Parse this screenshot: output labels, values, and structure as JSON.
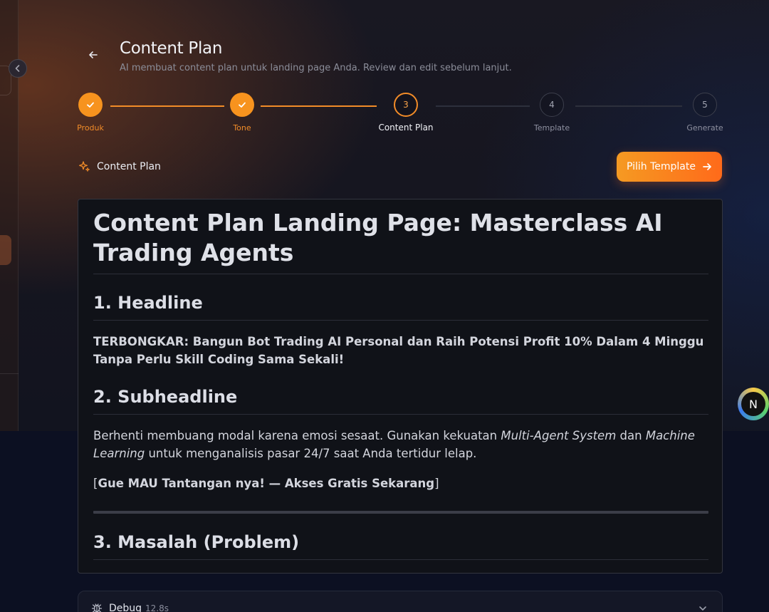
{
  "header": {
    "title": "Content Plan",
    "subtitle": "AI membuat content plan untuk landing page Anda. Review dan edit sebelum lanjut."
  },
  "stepper": {
    "steps": [
      {
        "label": "Produk",
        "number": "1",
        "state": "done"
      },
      {
        "label": "Tone",
        "number": "2",
        "state": "done"
      },
      {
        "label": "Content Plan",
        "number": "3",
        "state": "active"
      },
      {
        "label": "Template",
        "number": "4",
        "state": "pending"
      },
      {
        "label": "Generate",
        "number": "5",
        "state": "pending"
      }
    ]
  },
  "section": {
    "label": "Content Plan",
    "cta_label": "Pilih Template"
  },
  "document": {
    "title": "Content Plan Landing Page: Masterclass AI Trading Agents",
    "h_headline": "1. Headline",
    "headline_text": "TERBONGKAR: Bangun Bot Trading AI Personal dan Raih Potensi Profit 10% Dalam 4 Minggu Tanpa Perlu Skill Coding Sama Sekali!",
    "h_subheadline": "2. Subheadline",
    "sub_part1": "Berhenti membuang modal karena emosi sesaat. Gunakan kekuatan ",
    "sub_em1": "Multi-Agent System",
    "sub_part2": " dan ",
    "sub_em2": "Machine Learning",
    "sub_part3": " untuk menganalisis pasar 24/7 saat Anda tertidur lelap.",
    "cta_open": "[",
    "cta_text": "Gue MAU Tantangan nya! — Akses Gratis Sekarang",
    "cta_close": "]",
    "h_problem": "3. Masalah (Problem)"
  },
  "debug": {
    "label": "Debug",
    "time": "12.8s"
  },
  "avatar": {
    "initial": "N"
  },
  "colors": {
    "accent": "#f28c28",
    "accent_gradient_end": "#ff6a1a"
  }
}
